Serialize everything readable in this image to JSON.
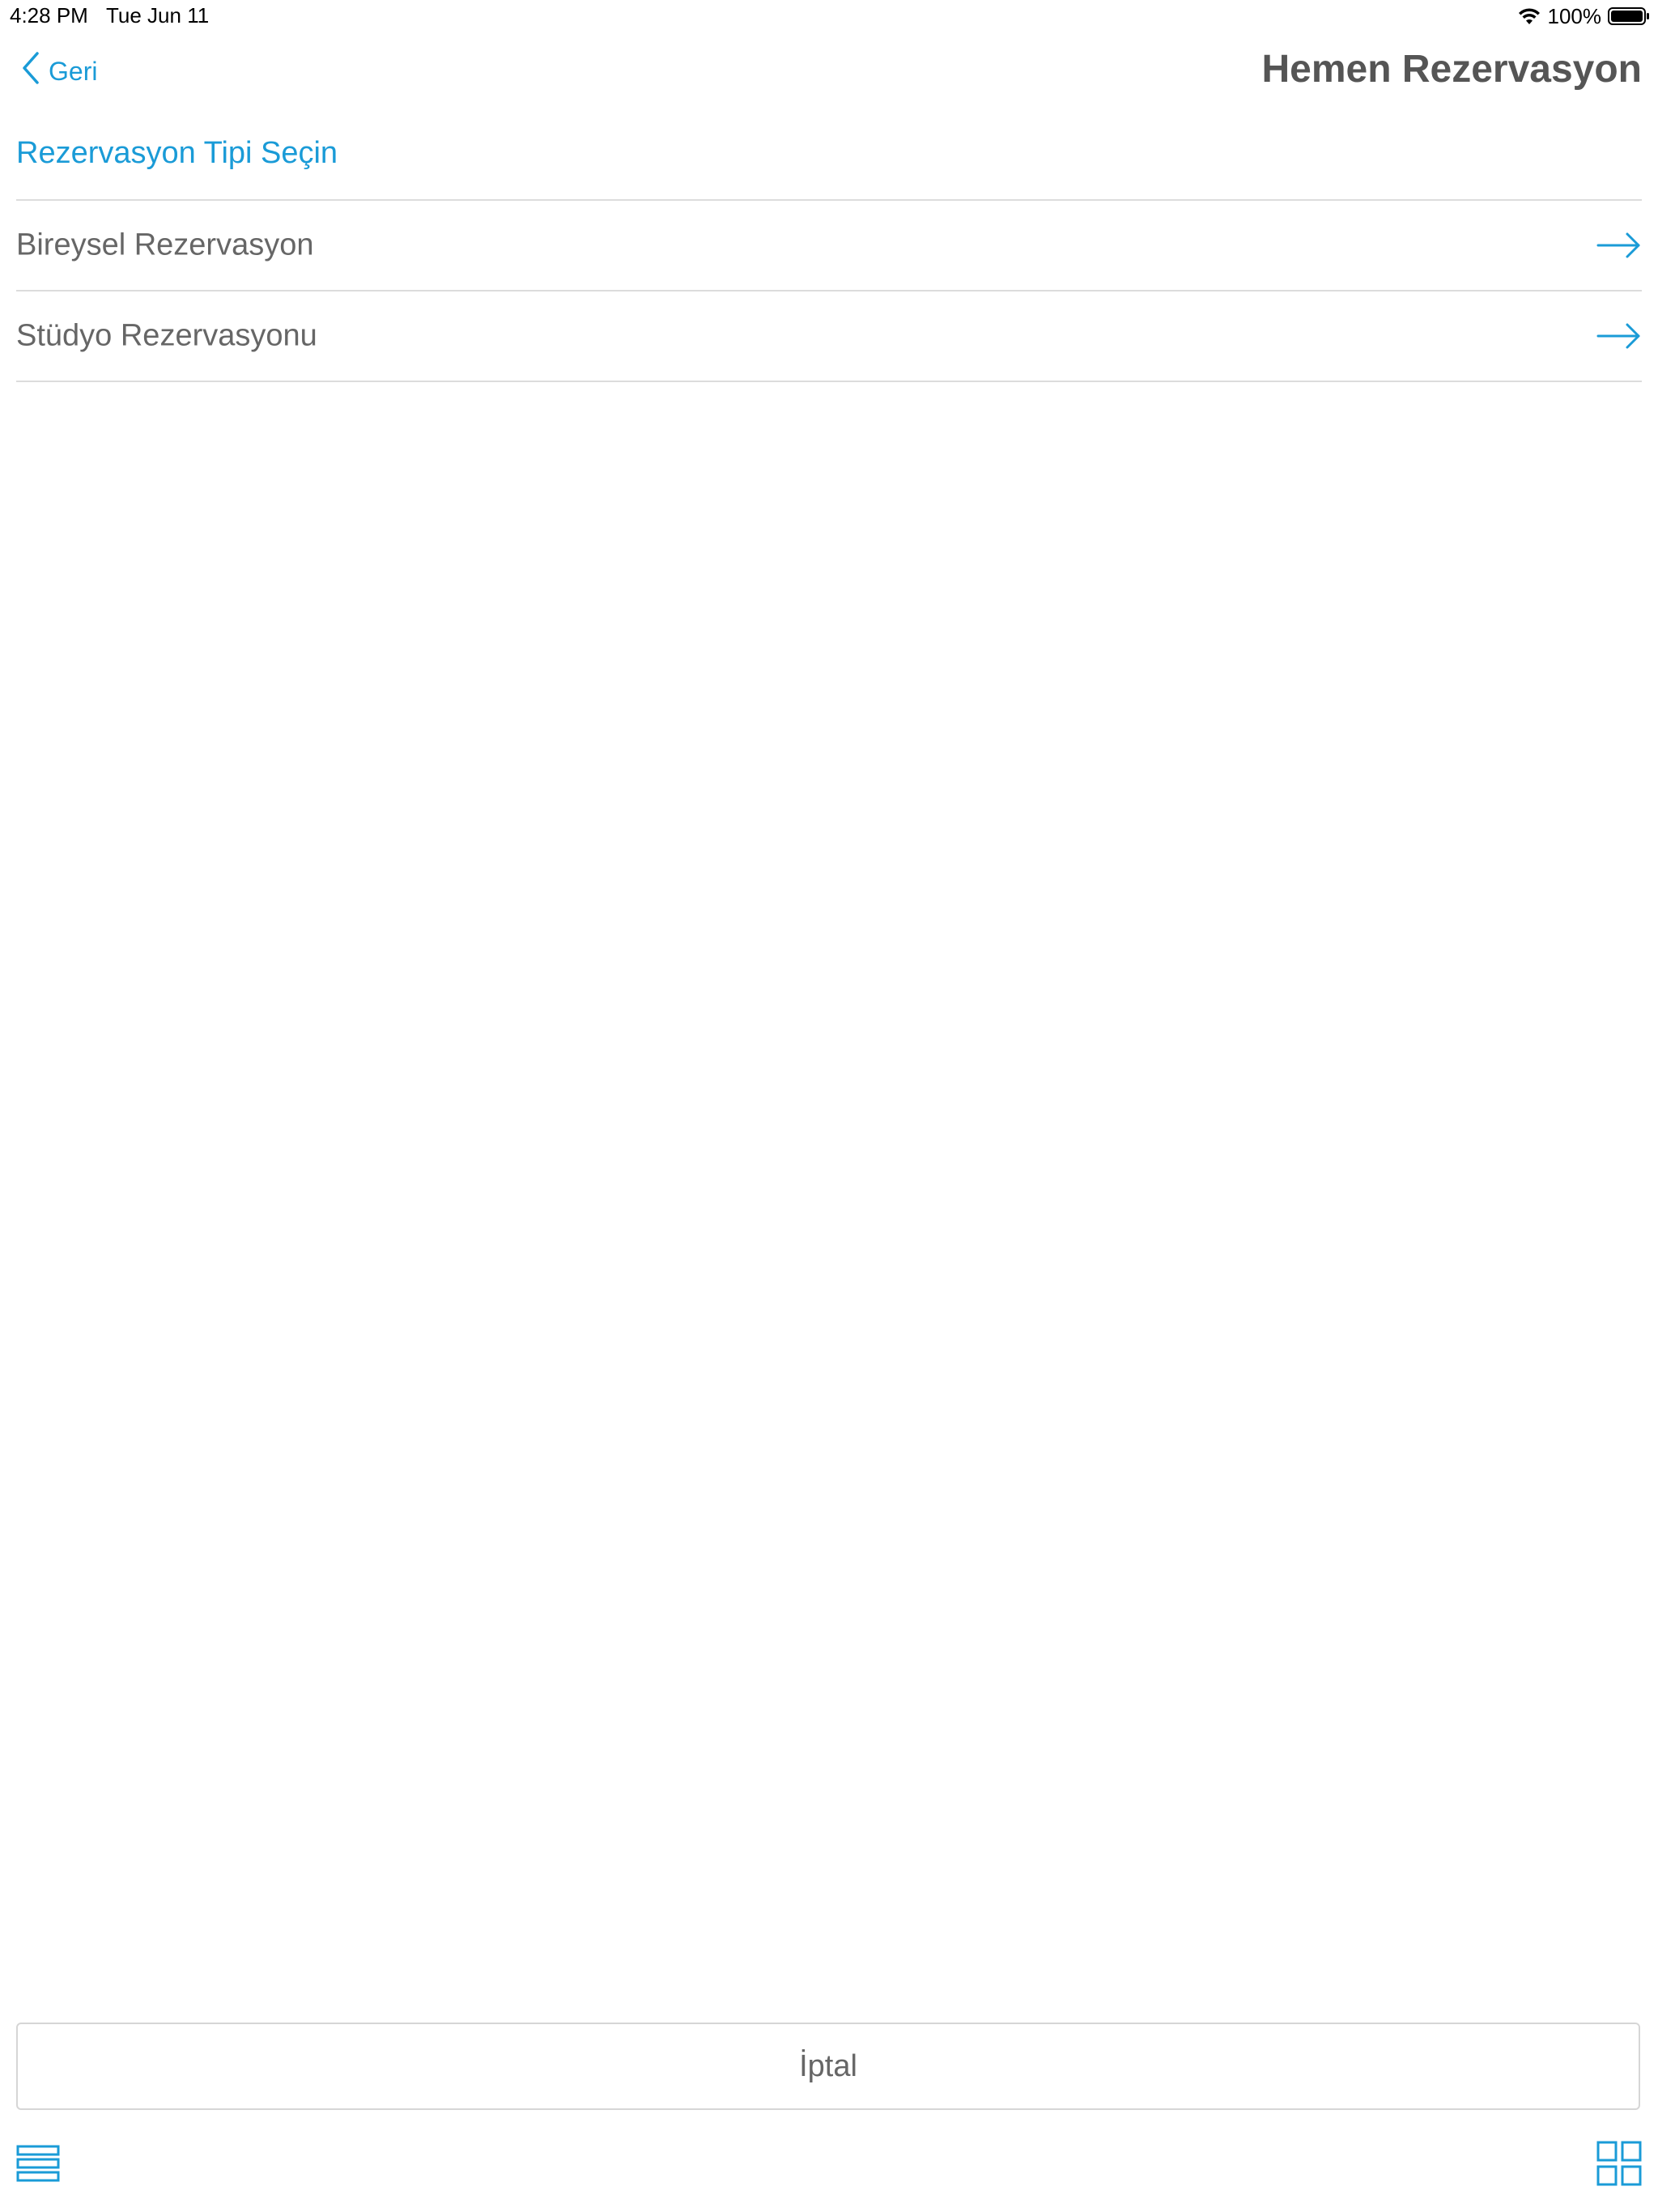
{
  "status_bar": {
    "time": "4:28 PM",
    "date": "Tue Jun 11",
    "battery": "100%",
    "icons": [
      "wifi-icon",
      "battery-icon"
    ]
  },
  "nav": {
    "back_label": "Geri",
    "back_icon": "chevron-left-icon",
    "title": "Hemen Rezervasyon"
  },
  "section": {
    "header": "Rezervasyon Tipi Seçin"
  },
  "options": [
    {
      "label": "Bireysel Rezervasyon",
      "icon": "arrow-right-icon"
    },
    {
      "label": "Stüdyo Rezervasyonu",
      "icon": "arrow-right-icon"
    }
  ],
  "cancel_label": "İptal",
  "toolbar": {
    "left_icon": "list-view-icon",
    "right_icon": "grid-view-icon"
  },
  "colors": {
    "accent": "#1a9bd7",
    "text": "#666666",
    "title": "#555555",
    "divider": "#dcdcdc"
  }
}
